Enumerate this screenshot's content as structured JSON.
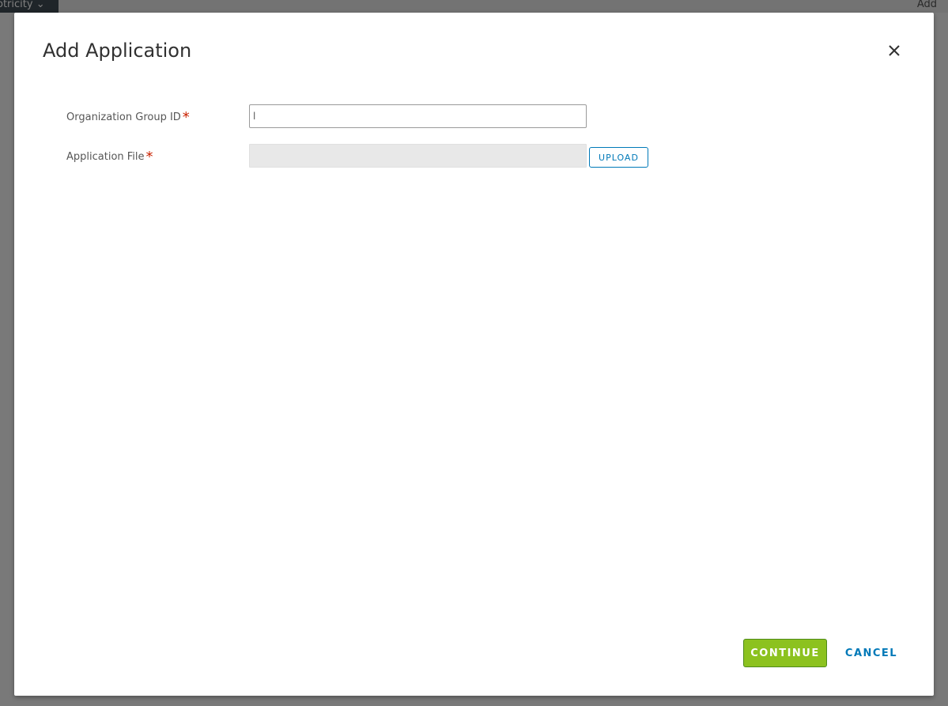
{
  "background": {
    "dropdown_label": "otricity",
    "add_label": "Add"
  },
  "modal": {
    "title": "Add Application",
    "close_icon": "close-icon",
    "fields": {
      "org_group_id": {
        "label": "Organization Group ID",
        "required_marker": "*",
        "value": "l"
      },
      "application_file": {
        "label": "Application File",
        "required_marker": "*",
        "upload_label": "UPLOAD"
      }
    },
    "footer": {
      "continue_label": "CONTINUE",
      "cancel_label": "CANCEL"
    }
  },
  "colors": {
    "accent_blue": "#0079b8",
    "continue_green": "#8cc21f",
    "required_red": "#c92100"
  }
}
